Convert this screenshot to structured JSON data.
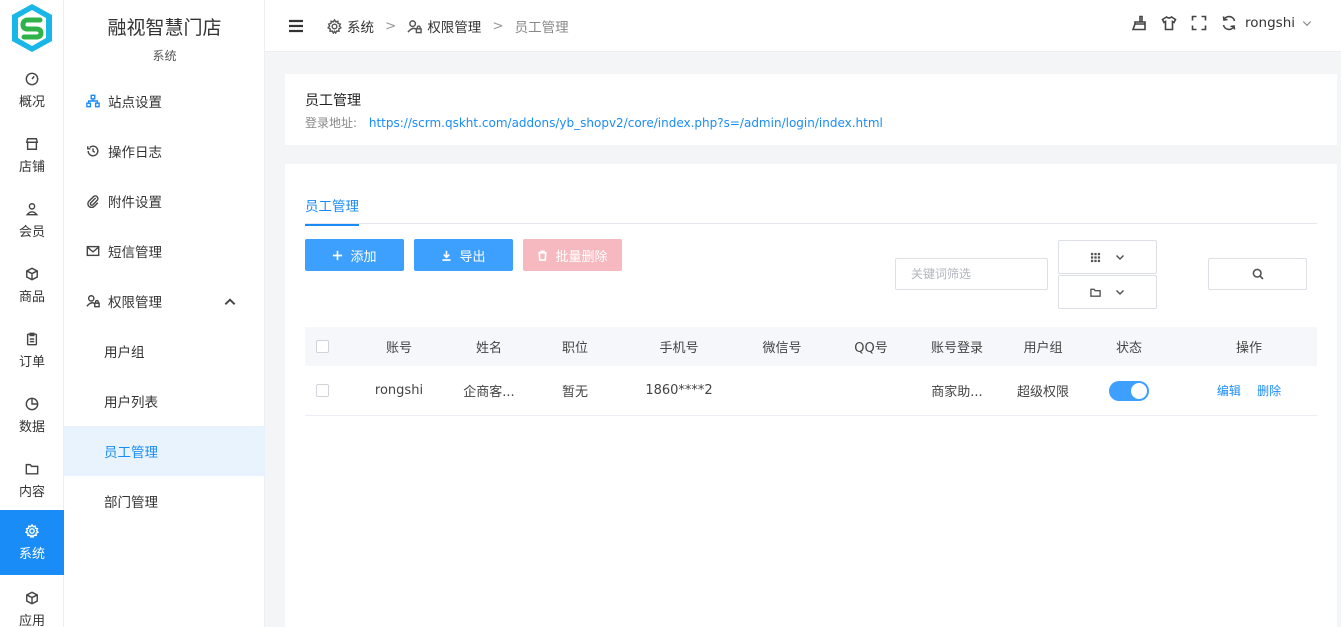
{
  "app": {
    "title": "融视智慧门店",
    "section": "系统"
  },
  "rail": [
    {
      "label": "概况",
      "icon": "dashboard-icon"
    },
    {
      "label": "店铺",
      "icon": "store-icon"
    },
    {
      "label": "会员",
      "icon": "user-icon"
    },
    {
      "label": "商品",
      "icon": "cube-icon"
    },
    {
      "label": "订单",
      "icon": "clipboard-icon"
    },
    {
      "label": "数据",
      "icon": "pie-icon"
    },
    {
      "label": "内容",
      "icon": "folder-icon"
    },
    {
      "label": "系统",
      "icon": "gear-icon",
      "active": true
    },
    {
      "label": "应用",
      "icon": "cube-icon"
    }
  ],
  "sidebar": {
    "items": [
      {
        "label": "站点设置",
        "icon": "sitemap-icon"
      },
      {
        "label": "操作日志",
        "icon": "history-icon"
      },
      {
        "label": "附件设置",
        "icon": "paperclip-icon"
      },
      {
        "label": "短信管理",
        "icon": "mail-icon"
      },
      {
        "label": "权限管理",
        "icon": "user-lock-icon",
        "expanded": true
      }
    ],
    "subitems": [
      {
        "label": "用户组"
      },
      {
        "label": "用户列表"
      },
      {
        "label": "员工管理",
        "active": true
      },
      {
        "label": "部门管理"
      }
    ]
  },
  "header": {
    "breadcrumb": [
      {
        "label": "系统",
        "icon": "gear-icon"
      },
      {
        "label": "权限管理",
        "icon": "user-lock-icon"
      },
      {
        "label": "员工管理"
      }
    ],
    "separator": ">",
    "username": "rongshi"
  },
  "info": {
    "title": "员工管理",
    "login_label": "登录地址:",
    "login_url": "https://scrm.qskht.com/addons/yb_shopv2/core/index.php?s=/admin/login/index.html"
  },
  "main": {
    "tab": "员工管理",
    "toolbar": {
      "add": "添加",
      "export": "导出",
      "batch_delete": "批量删除"
    },
    "filter": {
      "keyword_placeholder": "关键词筛选"
    },
    "table": {
      "headers": [
        "账号",
        "姓名",
        "职位",
        "手机号",
        "微信号",
        "QQ号",
        "账号登录",
        "用户组",
        "状态",
        "操作"
      ],
      "rows": [
        {
          "account": "rongshi",
          "name": "企商客...",
          "position": "暂无",
          "phone": "1860****2",
          "wechat": "",
          "qq": "",
          "login": "商家助...",
          "group": "超级权限",
          "status_on": true,
          "edit": "编辑",
          "delete": "删除"
        }
      ]
    }
  },
  "colors": {
    "primary": "#1a8cf7",
    "button": "#3d9ffe",
    "disabled": "#f6b9bf"
  }
}
